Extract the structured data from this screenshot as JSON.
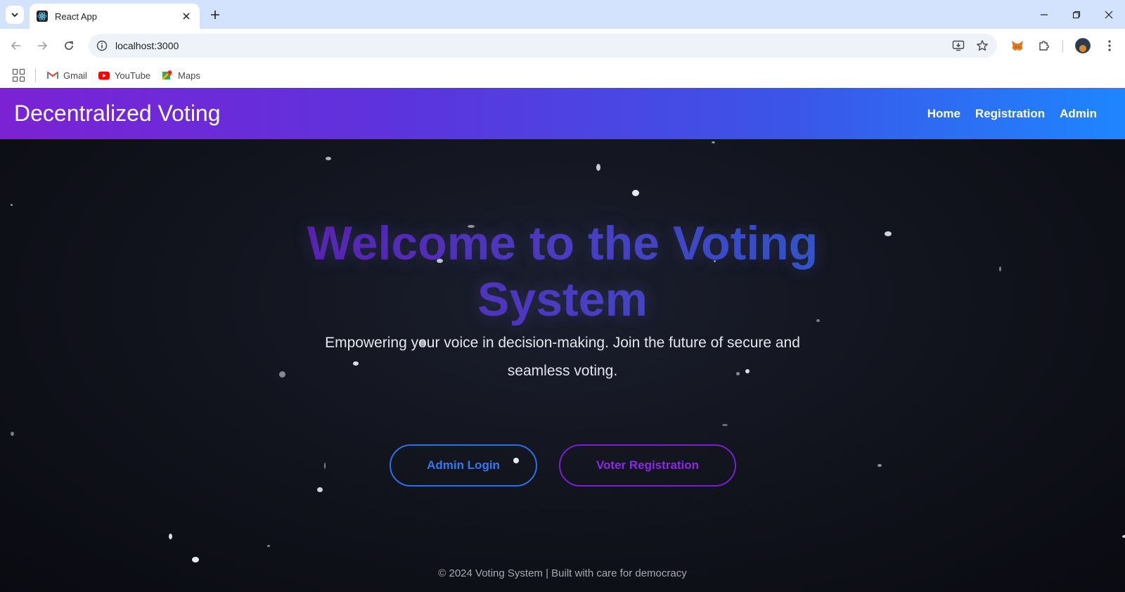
{
  "browser": {
    "tab": {
      "title": "React App"
    },
    "address": {
      "url": "localhost:3000"
    },
    "bookmarks": [
      {
        "label": "Gmail"
      },
      {
        "label": "YouTube"
      },
      {
        "label": "Maps"
      }
    ]
  },
  "navbar": {
    "brand": "Decentralized Voting",
    "links": [
      {
        "label": "Home"
      },
      {
        "label": "Registration"
      },
      {
        "label": "Admin"
      }
    ]
  },
  "hero": {
    "title": "Welcome to the Voting System",
    "subtitle": "Empowering your voice in decision-making. Join the future of secure and seamless voting.",
    "buttons": {
      "admin_login": "Admin Login",
      "voter_registration": "Voter Registration"
    }
  },
  "footer": {
    "text": "© 2024 Voting System | Built with care for democracy"
  },
  "colors": {
    "navbar_start": "#7b22d4",
    "navbar_end": "#1e86ff",
    "admin_button": "#2f6fe6",
    "voter_button": "#7a1fd0"
  },
  "icons": {
    "tab_favicon": "react-icon",
    "site_info": "info-icon",
    "install": "install-icon",
    "bookmark": "star-icon",
    "extension_metamask": "fox-icon",
    "extensions": "puzzle-icon",
    "menu": "kebab-icon"
  }
}
